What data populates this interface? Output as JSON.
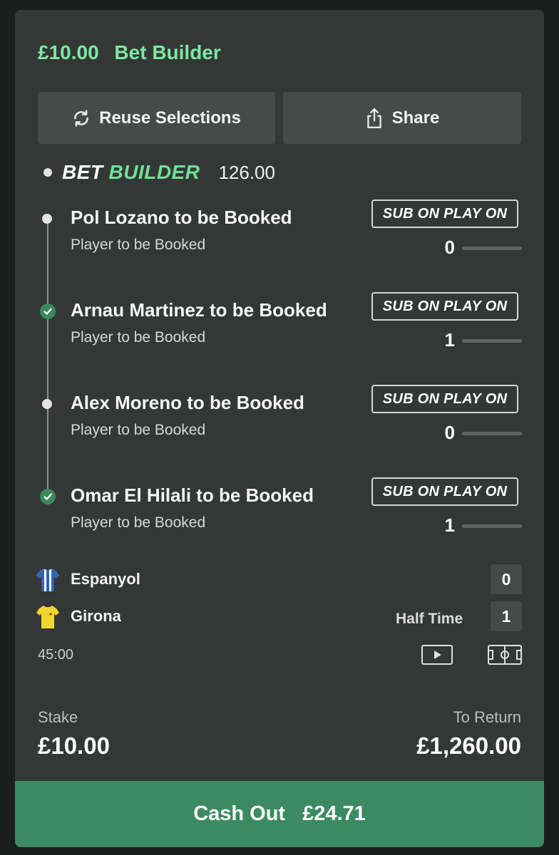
{
  "header": {
    "stake": "£10.00",
    "bet_type": "Bet Builder"
  },
  "actions": {
    "reuse_label": "Reuse Selections",
    "share_label": "Share"
  },
  "bet_builder": {
    "logo_word1": "BET",
    "logo_word2": "BUILDER",
    "odds": "126.00"
  },
  "selections": [
    {
      "title": "Pol Lozano to be Booked",
      "market": "Player to be Booked",
      "badge": "SUB ON PLAY ON",
      "count": "0",
      "progress": 0,
      "settled": false
    },
    {
      "title": "Arnau Martinez to be Booked",
      "market": "Player to be Booked",
      "badge": "SUB ON PLAY ON",
      "count": "1",
      "progress": 1,
      "settled": true
    },
    {
      "title": "Alex Moreno to be Booked",
      "market": "Player to be Booked",
      "badge": "SUB ON PLAY ON",
      "count": "0",
      "progress": 0,
      "settled": false
    },
    {
      "title": "Omar El Hilali to be Booked",
      "market": "Player to be Booked",
      "badge": "SUB ON PLAY ON",
      "count": "1",
      "progress": 1,
      "settled": true
    }
  ],
  "match": {
    "home": {
      "name": "Espanyol",
      "score": "0",
      "shirt_colors": [
        "#2f63b5",
        "#ffffff"
      ]
    },
    "away": {
      "name": "Girona",
      "score": "1",
      "shirt_colors": [
        "#f2d530",
        "#c0392b"
      ]
    },
    "status": "Half Time",
    "clock": "45:00"
  },
  "totals": {
    "stake_label": "Stake",
    "stake_value": "£10.00",
    "return_label": "To Return",
    "return_value": "£1,260.00"
  },
  "cashout": {
    "label": "Cash Out",
    "amount": "£24.71"
  },
  "colors": {
    "accent": "#7ee8a5",
    "cashout_bg": "#3b8a62",
    "card_bg": "#333735",
    "progress_fill": "#3e9a68"
  }
}
